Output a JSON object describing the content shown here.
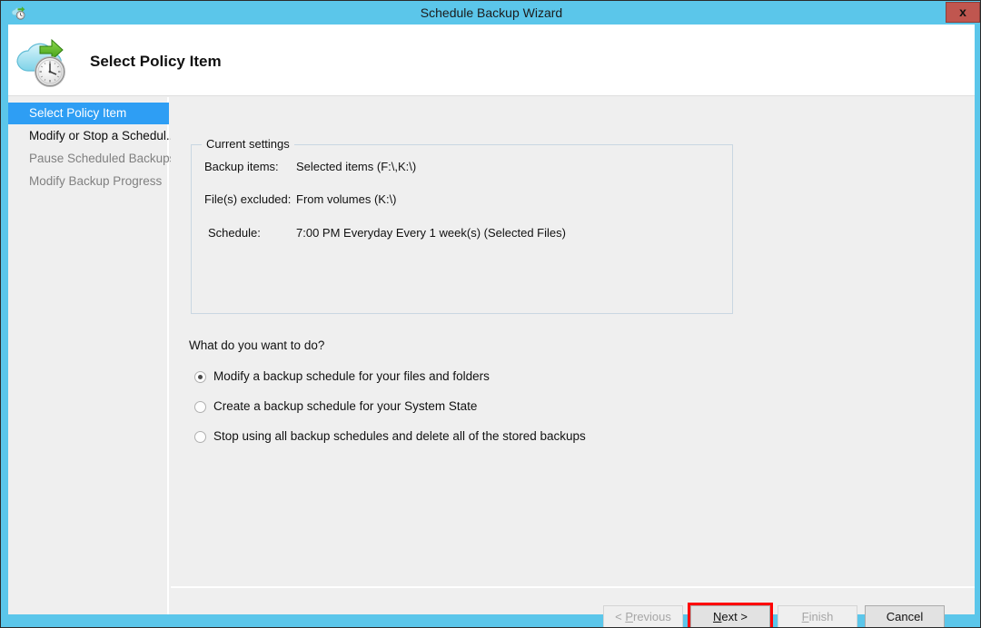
{
  "window": {
    "title": "Schedule Backup Wizard",
    "title_icon": "cloud-clock-icon",
    "close_label": "x"
  },
  "header": {
    "title": "Select Policy Item",
    "icon": "cloud-clock-backup-icon"
  },
  "sidebar": {
    "items": [
      {
        "label": "Select Policy Item",
        "state": "selected"
      },
      {
        "label": "Modify or Stop a Schedul...",
        "state": "normal"
      },
      {
        "label": "Pause Scheduled Backups",
        "state": "disabled"
      },
      {
        "label": "Modify Backup Progress",
        "state": "disabled"
      }
    ]
  },
  "current_settings": {
    "legend": "Current settings",
    "rows": [
      {
        "label": "Backup items:",
        "value": "Selected items (F:\\,K:\\)"
      },
      {
        "label": "File(s) excluded:",
        "value": "From volumes (K:\\)"
      },
      {
        "label": "Schedule:",
        "value": "7:00 PM Everyday Every 1 week(s) (Selected Files)"
      }
    ]
  },
  "prompt": {
    "question": "What do you want to do?",
    "options": [
      {
        "label": "Modify a backup schedule for your files and folders",
        "checked": true
      },
      {
        "label": "Create a backup schedule for your System State",
        "checked": false
      },
      {
        "label": "Stop using all backup schedules and delete all of the stored backups",
        "checked": false
      }
    ]
  },
  "buttons": {
    "previous": {
      "label": "< Previous",
      "accel": "P",
      "enabled": false
    },
    "next": {
      "label": "Next >",
      "accel": "N",
      "enabled": true,
      "highlighted": true
    },
    "finish": {
      "label": "Finish",
      "accel": "F",
      "enabled": false
    },
    "cancel": {
      "label": "Cancel",
      "accel": "",
      "enabled": true
    }
  },
  "colors": {
    "titlebar": "#5bc6ea",
    "accent_selected": "#2e9ef4",
    "close_button": "#c0564f",
    "highlight_ring": "#ff0000",
    "dialog_bg": "#efefef"
  }
}
